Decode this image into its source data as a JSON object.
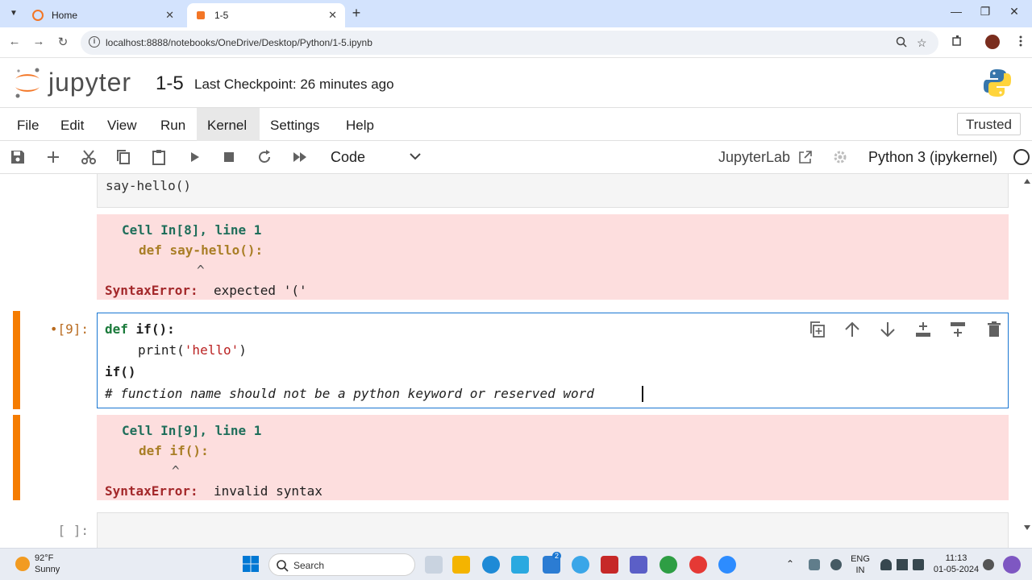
{
  "browser": {
    "tabs": [
      {
        "label": "Home",
        "active": false
      },
      {
        "label": "1-5",
        "active": true
      }
    ],
    "url": "localhost:8888/notebooks/OneDrive/Desktop/Python/1-5.ipynb"
  },
  "header": {
    "logo_text": "jupyter",
    "notebook_name": "1-5",
    "checkpoint": "Last Checkpoint: 26 minutes ago"
  },
  "menu": {
    "items": [
      "File",
      "Edit",
      "View",
      "Run",
      "Kernel",
      "Settings",
      "Help"
    ],
    "active": "Kernel",
    "trusted_label": "Trusted"
  },
  "toolbar": {
    "cell_type": "Code",
    "jupyterlab_label": "JupyterLab",
    "kernel_name": "Python 3 (ipykernel)"
  },
  "cells": {
    "cell8_partial_code": "say-hello()",
    "error8": {
      "line1_cell": "Cell In[8], line 1",
      "line2_code": "def say-hello():",
      "caret": "^",
      "error_name": "SyntaxError:",
      "error_msg": "expected '('"
    },
    "cell9": {
      "prompt": "•[9]:",
      "kw_def": "def",
      "func_name": "if():",
      "print_fn": "print(",
      "print_arg": "'hello'",
      "print_close": ")",
      "call_line": "if()",
      "comment": "# function name should not be a python keyword or reserved word"
    },
    "error9": {
      "line1_cell": "Cell In[9], line 1",
      "line2_code": "def if():",
      "caret": "^",
      "error_name": "SyntaxError:",
      "error_msg": "invalid syntax"
    },
    "empty_prompt": "[ ]:"
  },
  "taskbar": {
    "temperature": "92°F",
    "condition": "Sunny",
    "search_label": "Search",
    "lang": "ENG",
    "region": "IN",
    "time": "11:13",
    "date": "01-05-2024",
    "badge": "2"
  }
}
